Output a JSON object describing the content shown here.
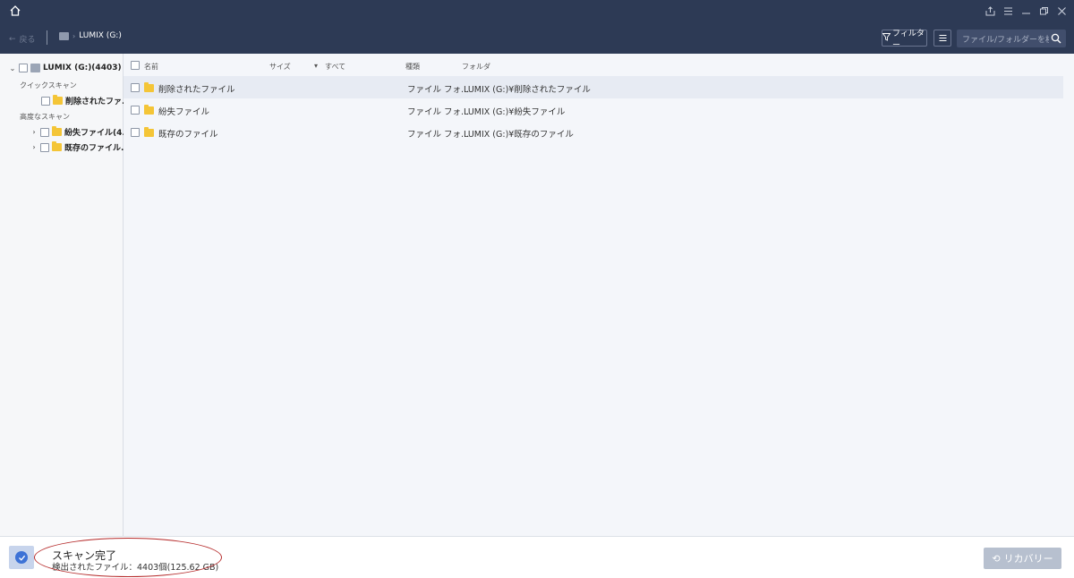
{
  "titlebar": {
    "icons": [
      "home-icon",
      "share-icon",
      "menu-icon",
      "minimize-icon",
      "restore-icon",
      "close-icon"
    ]
  },
  "toolbar": {
    "back_label": "戻る",
    "breadcrumb": "LUMIX (G:)",
    "filter_label": "フィルター",
    "search_placeholder": "ファイル/フォルダーを検索"
  },
  "sidebar": {
    "root_label": "LUMIX (G:)(4403)",
    "quick_scan_label": "クイックスキャン",
    "quick_items": [
      {
        "label": "削除されたファ..."
      }
    ],
    "advanced_scan_label": "高度なスキャン",
    "advanced_items": [
      {
        "label": "紛失ファイル(4..."
      },
      {
        "label": "既存のファイル..."
      }
    ]
  },
  "table": {
    "headers": {
      "name": "名前",
      "size": "サイズ",
      "date": "すべて",
      "type": "種類",
      "folder": "フォルダ"
    },
    "rows": [
      {
        "name": "削除されたファイル",
        "type": "ファイル フォ...",
        "folder": "LUMIX (G:)¥削除されたファイル"
      },
      {
        "name": "紛失ファイル",
        "type": "ファイル フォ...",
        "folder": "LUMIX (G:)¥紛失ファイル"
      },
      {
        "name": "既存のファイル",
        "type": "ファイル フォ...",
        "folder": "LUMIX (G:)¥既存のファイル"
      }
    ]
  },
  "status": {
    "title": "スキャン完了",
    "subtitle": "検出されたファイル：4403個(125.62 GB)",
    "recover_label": "リカバリー"
  },
  "colors": {
    "header_bg": "#2d3a55",
    "folder": "#f4c537",
    "annotation": "#b52a2a",
    "accent": "#3d72d6"
  }
}
